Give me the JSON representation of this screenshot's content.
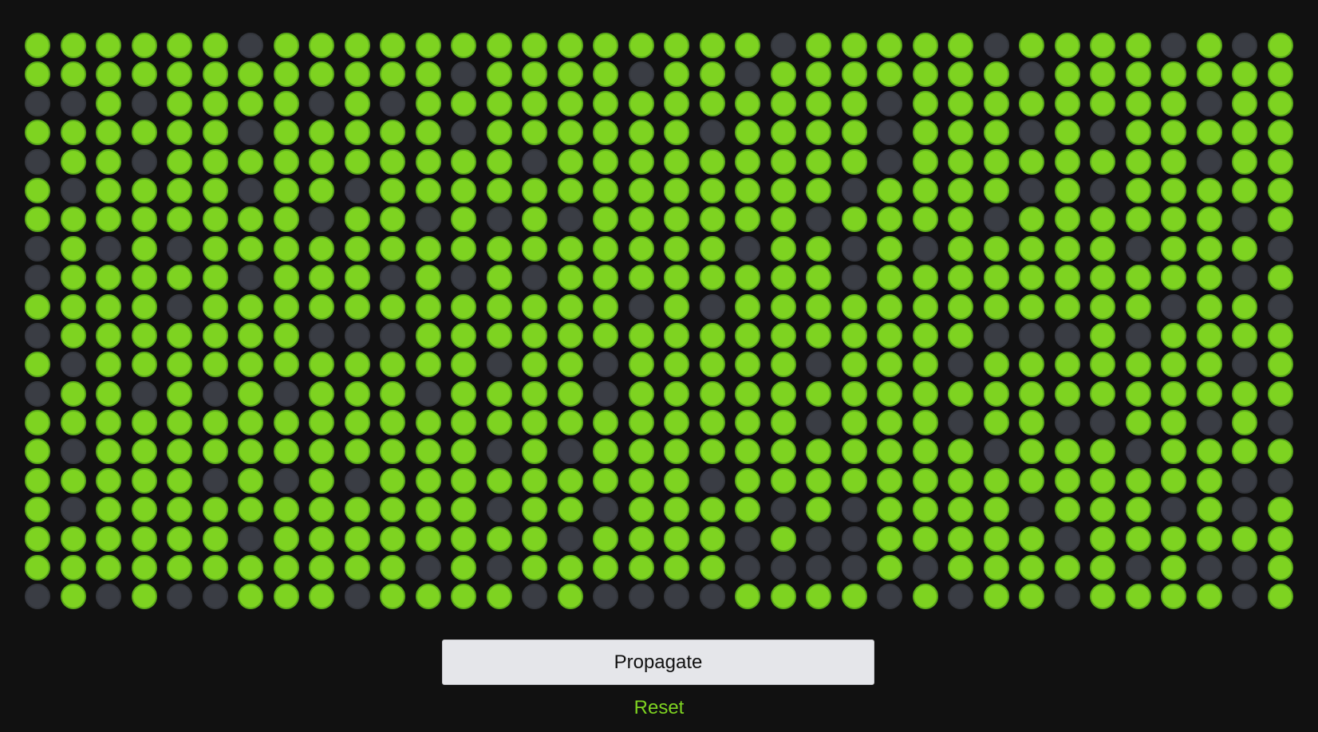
{
  "grid": {
    "columns": 36,
    "rows": 20,
    "on_color": "#7ed321",
    "off_color": "#3a3d44",
    "cells": [
      "111111011111111111111011111011110101",
      "111111111111011110110111111101111111",
      "001011110101111111111111011111111011",
      "111111011111011111101111011101011111",
      "011011111111110111111111011111111011",
      "101111011011111111111110111101011111",
      "111111110110101011111101111011111101",
      "010101111111111111110110101111101110",
      "011111011101010111111110111111111101",
      "111101111111111110101111111111110110",
      "011111110001111111111111111000101111",
      "101111111111101101111101110111111101",
      "011010101110111101111111111111111111",
      "111111111111111111111101110110011010",
      "101111111111101011111111111011101111",
      "111110101011111111101111111111111100",
      "101111111111101101111010111101110101",
      "111111011111111011110100111110111111",
      "111111111110101111110000101111101001",
      "010100111011110100001111010110111101"
    ]
  },
  "actions": {
    "propagate_label": "Propagate",
    "reset_label": "Reset"
  }
}
